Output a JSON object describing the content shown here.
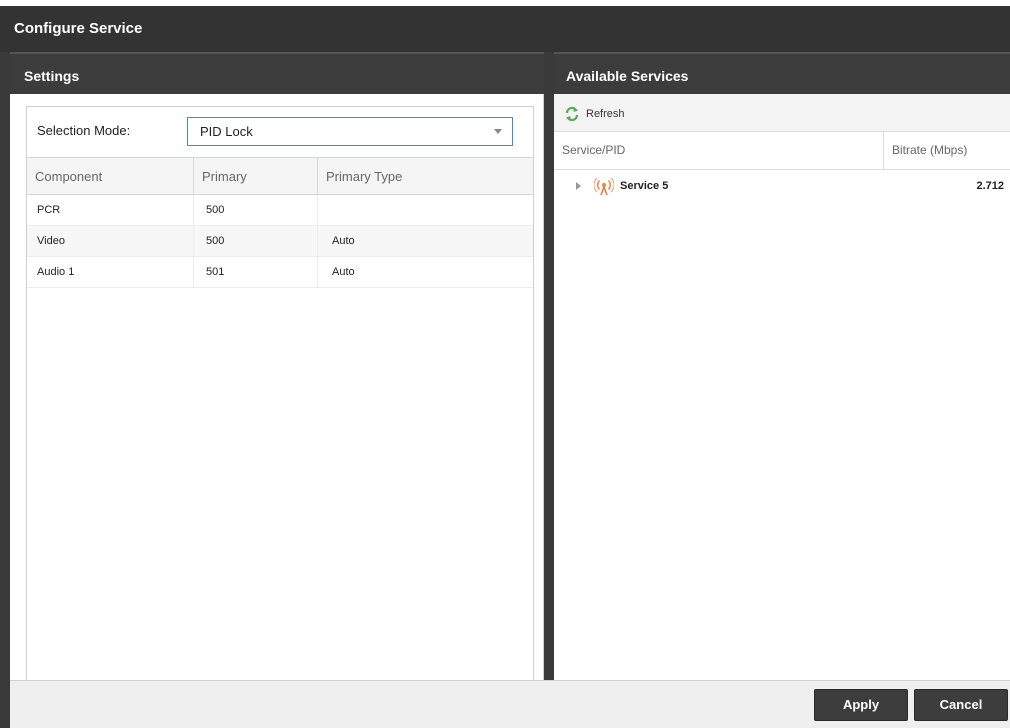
{
  "dialog": {
    "title": "Configure Service"
  },
  "settings": {
    "header": "Settings",
    "selection_mode_label": "Selection Mode:",
    "selection_mode_value": "PID Lock",
    "columns": [
      "Component",
      "Primary",
      "Primary Type"
    ],
    "rows": [
      {
        "component": "PCR",
        "primary": "500",
        "primary_type": ""
      },
      {
        "component": "Video",
        "primary": "500",
        "primary_type": "Auto"
      },
      {
        "component": "Audio 1",
        "primary": "501",
        "primary_type": "Auto"
      }
    ]
  },
  "services": {
    "header": "Available Services",
    "refresh_label": "Refresh",
    "columns": [
      "Service/PID",
      "Bitrate (Mbps)"
    ],
    "rows": [
      {
        "name": "Service 5",
        "bitrate": "2.712"
      }
    ]
  },
  "footer": {
    "apply_label": "Apply",
    "cancel_label": "Cancel"
  },
  "colors": {
    "titlebar": "#333333",
    "header": "#3c3c3c",
    "accent": "#3b8fd6",
    "button": "#3d3d3d",
    "refresh_icon": "#4caf50",
    "service_icon": "#f08a4b"
  },
  "icons": {
    "refresh": "refresh-icon",
    "service": "service-antenna-icon",
    "expander": "expand-arrow-icon"
  }
}
